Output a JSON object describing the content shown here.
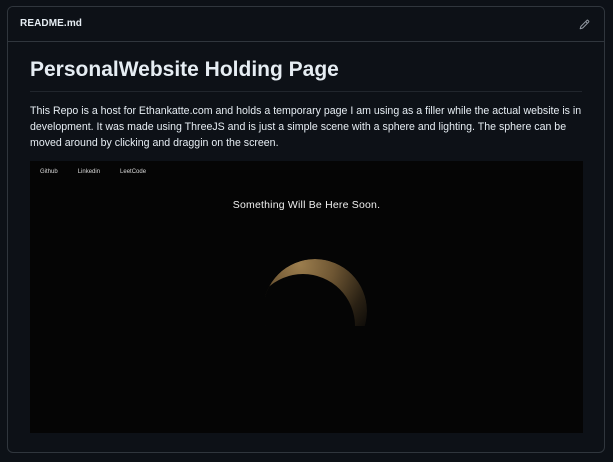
{
  "readme": {
    "filename": "README.md",
    "edit_icon": "pencil-icon"
  },
  "content": {
    "title": "PersonalWebsite Holding Page",
    "description": "This Repo is a host for Ethankatte.com and holds a temporary page I am using as a filler while the actual website is in development. It was made using ThreeJS and is just a simple scene with a sphere and lighting. The sphere can be moved around by clicking and draggin on the screen."
  },
  "preview": {
    "nav": {
      "github": "Github",
      "linkedin": "Linkedin",
      "leetcode": "LeetCode"
    },
    "headline": "Something Will Be Here Soon.",
    "sphere_icon": "lit-sphere"
  },
  "colors": {
    "background": "#0d1117",
    "border": "#30363d",
    "text": "#e6edf3",
    "preview_bg": "#050505",
    "sphere_light": "#8a6f45"
  }
}
